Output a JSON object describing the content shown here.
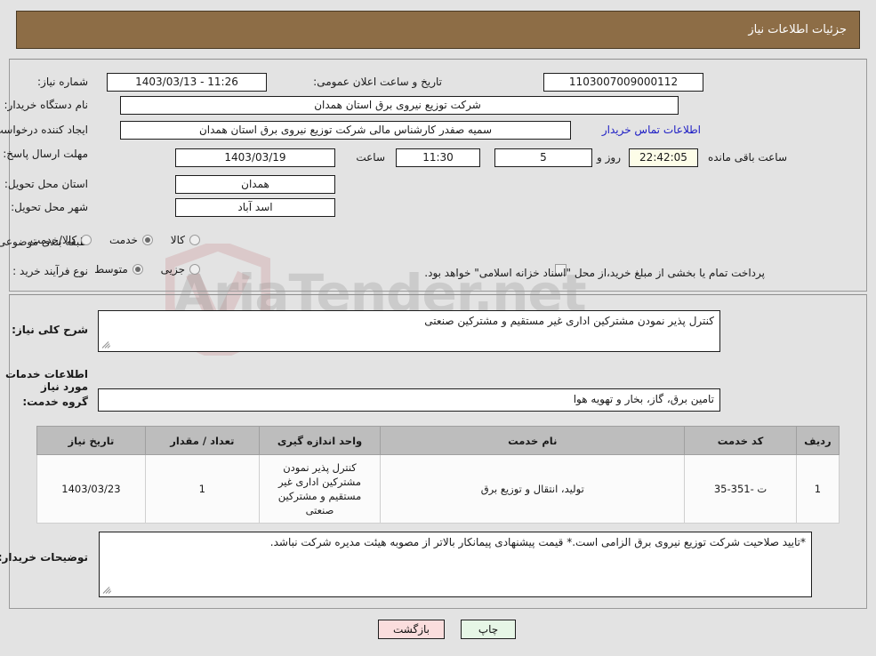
{
  "header": {
    "title": "جزئیات اطلاعات نیاز"
  },
  "form": {
    "need_number_label": "شماره نیاز:",
    "need_number_value": "1103007009000112",
    "announce_label": "تاریخ و ساعت اعلان عمومی:",
    "announce_value": "11:26 - 1403/03/13",
    "buyer_org_label": "نام دستگاه خریدار:",
    "buyer_org_value": "شرکت توزیع نیروی برق استان همدان",
    "creator_label": "ایجاد کننده درخواست:",
    "creator_value": "سمیه صفدر کارشناس مالی شرکت توزیع نیروی برق استان همدان",
    "contact_link": "اطلاعات تماس خریدار",
    "deadline_label": "مهلت ارسال پاسخ: تا تاریخ:",
    "deadline_date": "1403/03/19",
    "hour_label": "ساعت",
    "deadline_time": "11:30",
    "days_value": "5",
    "days_label": "روز و",
    "remaining_time": "22:42:05",
    "remaining_label": "ساعت باقی مانده",
    "province_label": "استان محل تحویل:",
    "province_value": "همدان",
    "city_label": "شهر محل تحویل:",
    "city_value": "اسد آباد",
    "category_label": "طبقه بندی موضوعی:",
    "category_options": [
      {
        "label": "کالا",
        "selected": false
      },
      {
        "label": "خدمت",
        "selected": true
      },
      {
        "label": "کالا/خدمت",
        "selected": false
      }
    ],
    "process_label": "نوع فرآیند خرید :",
    "process_options": [
      {
        "label": "جزیی",
        "selected": false
      },
      {
        "label": "متوسط",
        "selected": true
      }
    ],
    "treasury_checkbox_label": "پرداخت تمام یا بخشی از مبلغ خرید،از محل \"اسناد خزانه اسلامی\" خواهد بود.",
    "treasury_checked": false
  },
  "body": {
    "summary_label": "شرح کلی نیاز:",
    "summary_value": "کنترل پذیر نمودن مشترکین اداری غیر مستقیم و مشترکین صنعتی",
    "services_section_title": "اطلاعات خدمات مورد نیاز",
    "service_group_label": "گروه خدمت:",
    "service_group_value": "تامین برق، گاز، بخار و تهویه هوا",
    "buyer_notes_label": "توضیحات خریدار:",
    "buyer_notes_value": "*تایید صلاحیت شرکت توزیع نیروی برق الزامی است.* قیمت پیشنهادی پیمانکار بالاتر از مصوبه هیئت مدیره شرکت نباشد."
  },
  "table": {
    "columns": [
      "ردیف",
      "کد خدمت",
      "نام خدمت",
      "واحد اندازه گیری",
      "تعداد / مقدار",
      "تاریخ نیاز"
    ],
    "rows": [
      {
        "row": "1",
        "service_code": "ت -351-35",
        "service_name": "تولید، انتقال و توزیع برق",
        "unit": "کنترل پذیر نمودن مشترکین اداری غیر مستقیم و مشترکین صنعتی",
        "quantity": "1",
        "need_date": "1403/03/23"
      }
    ]
  },
  "buttons": {
    "back": "بازگشت",
    "print": "چاپ"
  },
  "watermark": {
    "text": "AriaTender.net"
  },
  "colors": {
    "header_bar": "#8d6d46",
    "page_background": "#e3e3e3",
    "link": "#1b1bc4",
    "back_button": "#fadddd",
    "print_button": "#e6f6e6",
    "table_header": "#bdbdbd",
    "countdown_field": "#fdfde8"
  }
}
